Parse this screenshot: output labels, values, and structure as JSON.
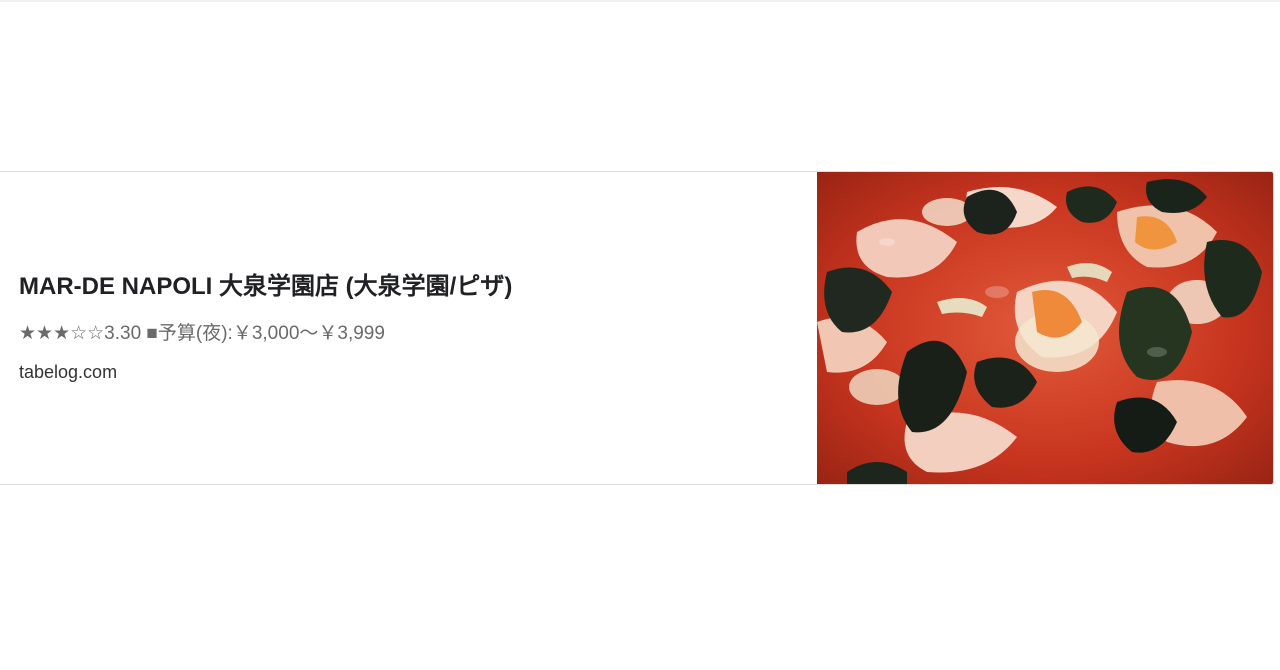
{
  "link_card": {
    "title": "MAR-DE NAPOLI 大泉学園店 (大泉学園/ピザ)",
    "description": "★★★☆☆3.30 ■予算(夜):￥3,000～￥3,999",
    "domain": "tabelog.com",
    "thumbnail_icon": "pizza-photo"
  }
}
